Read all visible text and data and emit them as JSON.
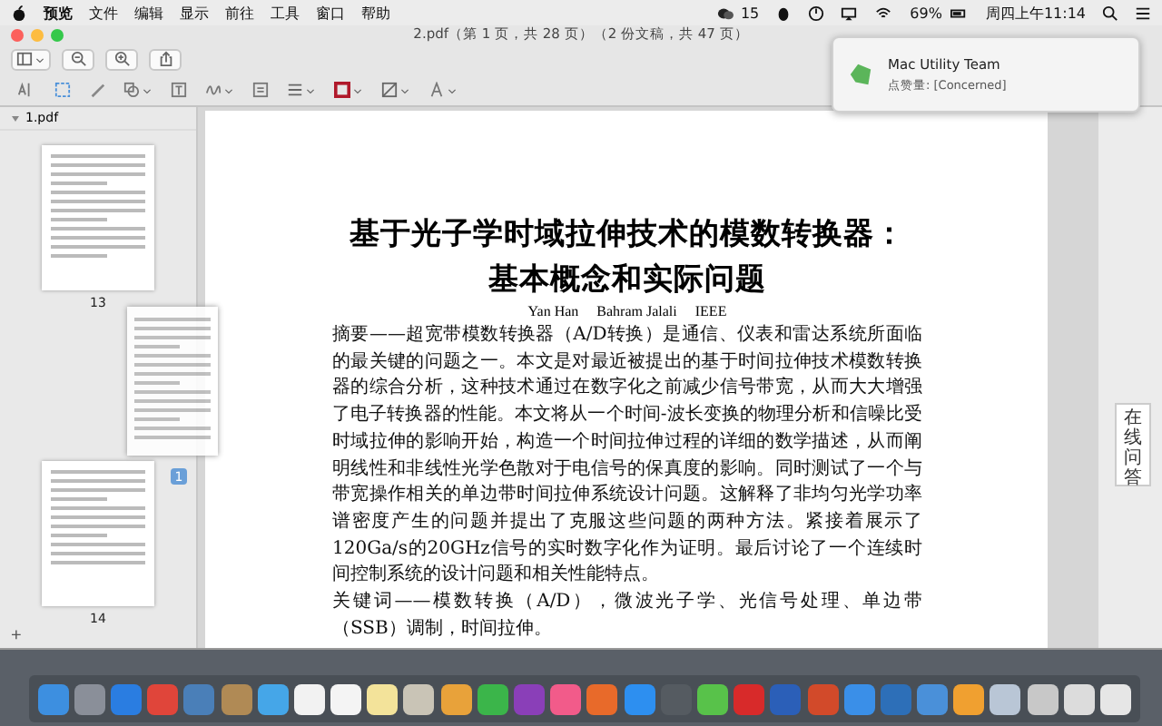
{
  "menu_bar": {
    "menus": [
      "预览",
      "文件",
      "编辑",
      "显示",
      "前往",
      "工具",
      "窗口",
      "帮助"
    ],
    "wechat_count": "15",
    "battery": "69%",
    "clock": "周四上午11:14"
  },
  "window": {
    "title": "2.pdf（第 1 页，共 28 页）（2 份文稿，共 47 页）"
  },
  "notification": {
    "title": "Mac Utility Team",
    "text": "点赞量: [Concerned]"
  },
  "sidebar": {
    "document": "1.pdf",
    "expanded": true,
    "pages": [
      {
        "label": "13",
        "selected": false
      },
      {
        "label": "14",
        "selected": false
      }
    ],
    "badge": "1",
    "add_button": "+"
  },
  "document": {
    "title_lines": [
      "基于光子学时域拉伸技术的模数转换器：",
      "基本概念和实际问题"
    ],
    "authors": [
      "Yan Han",
      "Bahram Jalali",
      "IEEE"
    ],
    "paragraphs": [
      "摘要——超宽带模数转换器（A/D转换）是通信、仪表和雷达系统所面临的最关键的问题之一。本文是对最近被提出的基于时间拉伸技术模数转换器的综合分析，这种技术通过在数字化之前减少信号带宽，从而大大增强了电子转换器的性能。本文将从一个时间-波长变换的物理分析和信噪比受时域拉伸的影响开始，构造一个时间拉伸过程的详细的数学描述，从而阐明线性和非线性光学色散对于电信号的保真度的影响。同时测试了一个与带宽操作相关的单边带时间拉伸系统设计问题。这解释了非均匀光学功率谱密度产生的问题并提出了克服这些问题的两种方法。紧接着展示了120Ga/s的20GHz信号的实时数字化作为证明。最后讨论了一个连续时间控制系统的设计问题和相关性能特点。",
      "关键词——模数转换（A/D），微波光子学、光信号处理、单边带（SSB）调制，时间拉伸。"
    ]
  },
  "side_tab": {
    "label": "在线问答"
  }
}
